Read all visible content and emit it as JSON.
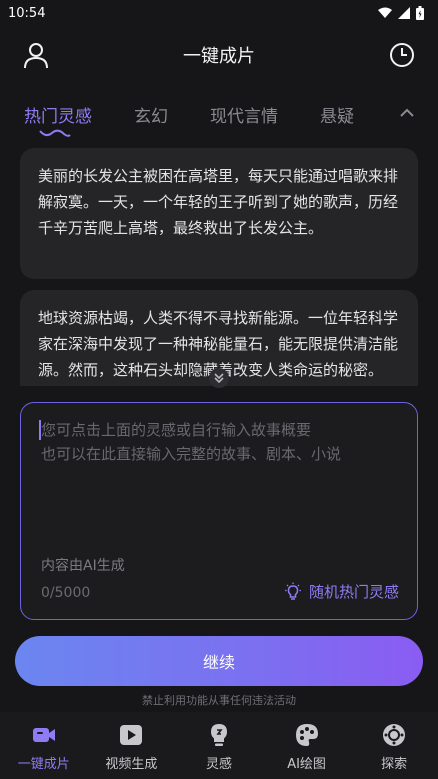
{
  "status_bar": {
    "time": "10:54"
  },
  "header": {
    "title": "一键成片",
    "left_icon": "user-icon",
    "right_icon": "history-clock-icon"
  },
  "tabs": [
    {
      "label": "热门灵感",
      "active": true
    },
    {
      "label": "玄幻",
      "active": false
    },
    {
      "label": "现代言情",
      "active": false
    },
    {
      "label": "悬疑",
      "active": false
    }
  ],
  "stories": [
    {
      "text": "美丽的长发公主被困在高塔里，每天只能通过唱歌来排解寂寞。一天，一个年轻的王子听到了她的歌声，历经千辛万苦爬上高塔，最终救出了长发公主。"
    },
    {
      "text": "地球资源枯竭，人类不得不寻找新能源。一位年轻科学家在深海中发现了一种神秘能量石，能无限提供清洁能源。然而，这种石头却隐藏着改变人类命运的秘密。"
    }
  ],
  "input": {
    "placeholder": "您可点击上面的灵感或自行输入故事概要\n也可以在此直接输入完整的故事、剧本、小说",
    "ai_note": "内容由AI生成",
    "counter": "0/5000",
    "random_label": "随机热门灵感"
  },
  "continue_label": "继续",
  "disclaimer": "禁止利用功能从事任何违法活动",
  "nav": [
    {
      "label": "一键成片",
      "icon": "video-camera-icon",
      "active": true
    },
    {
      "label": "视频生成",
      "icon": "play-icon",
      "active": false
    },
    {
      "label": "灵感",
      "icon": "lightbulb-icon",
      "active": false
    },
    {
      "label": "AI绘图",
      "icon": "palette-icon",
      "active": false
    },
    {
      "label": "探索",
      "icon": "compass-icon",
      "active": false
    }
  ],
  "colors": {
    "accent": "#8f7bf3",
    "background": "#161618",
    "card": "#252528",
    "button_gradient_start": "#6b86f0",
    "button_gradient_end": "#8a5cf2"
  }
}
